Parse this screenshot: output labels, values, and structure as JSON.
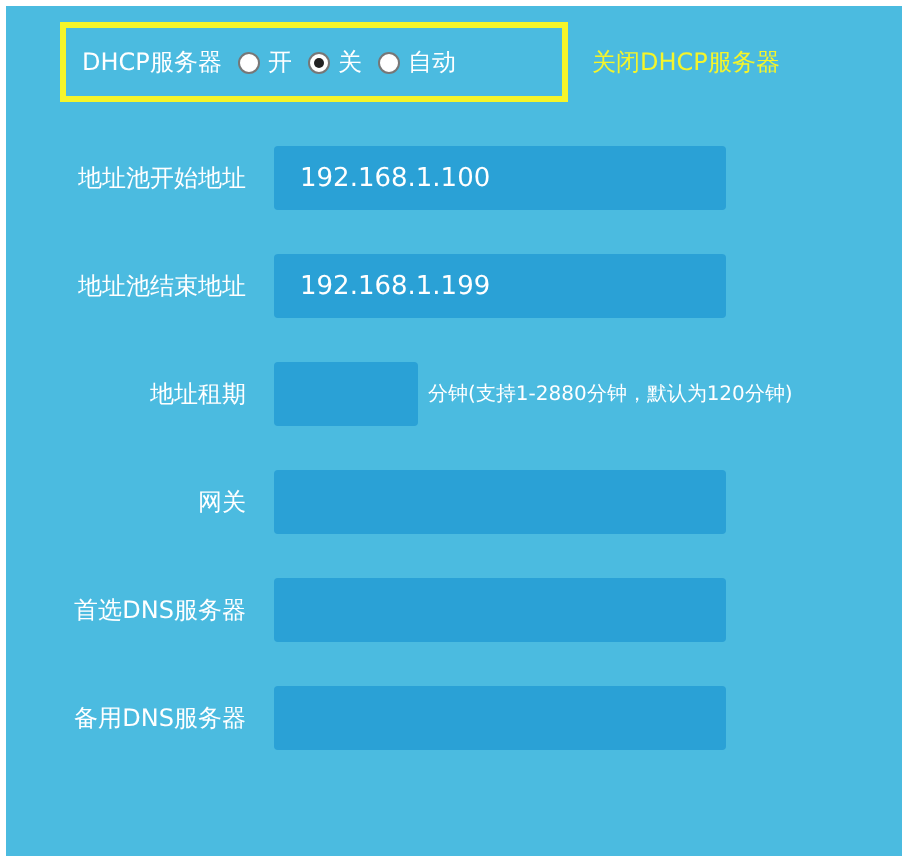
{
  "dhcp_server": {
    "label": "DHCP服务器",
    "options": [
      {
        "label": "开",
        "selected": false
      },
      {
        "label": "关",
        "selected": true
      },
      {
        "label": "自动",
        "selected": false
      }
    ],
    "hint": "关闭DHCP服务器"
  },
  "fields": [
    {
      "label": "地址池开始地址",
      "value": "192.168.1.100",
      "kind": "wide"
    },
    {
      "label": "地址池结束地址",
      "value": "192.168.1.199",
      "kind": "wide"
    },
    {
      "label": "地址租期",
      "kind": "short",
      "note": "分钟(支持1-2880分钟，默认为120分钟)"
    },
    {
      "label": "网关",
      "kind": "wide"
    },
    {
      "label": "首选DNS服务器",
      "kind": "wide"
    },
    {
      "label": "备用DNS服务器",
      "kind": "wide"
    }
  ]
}
